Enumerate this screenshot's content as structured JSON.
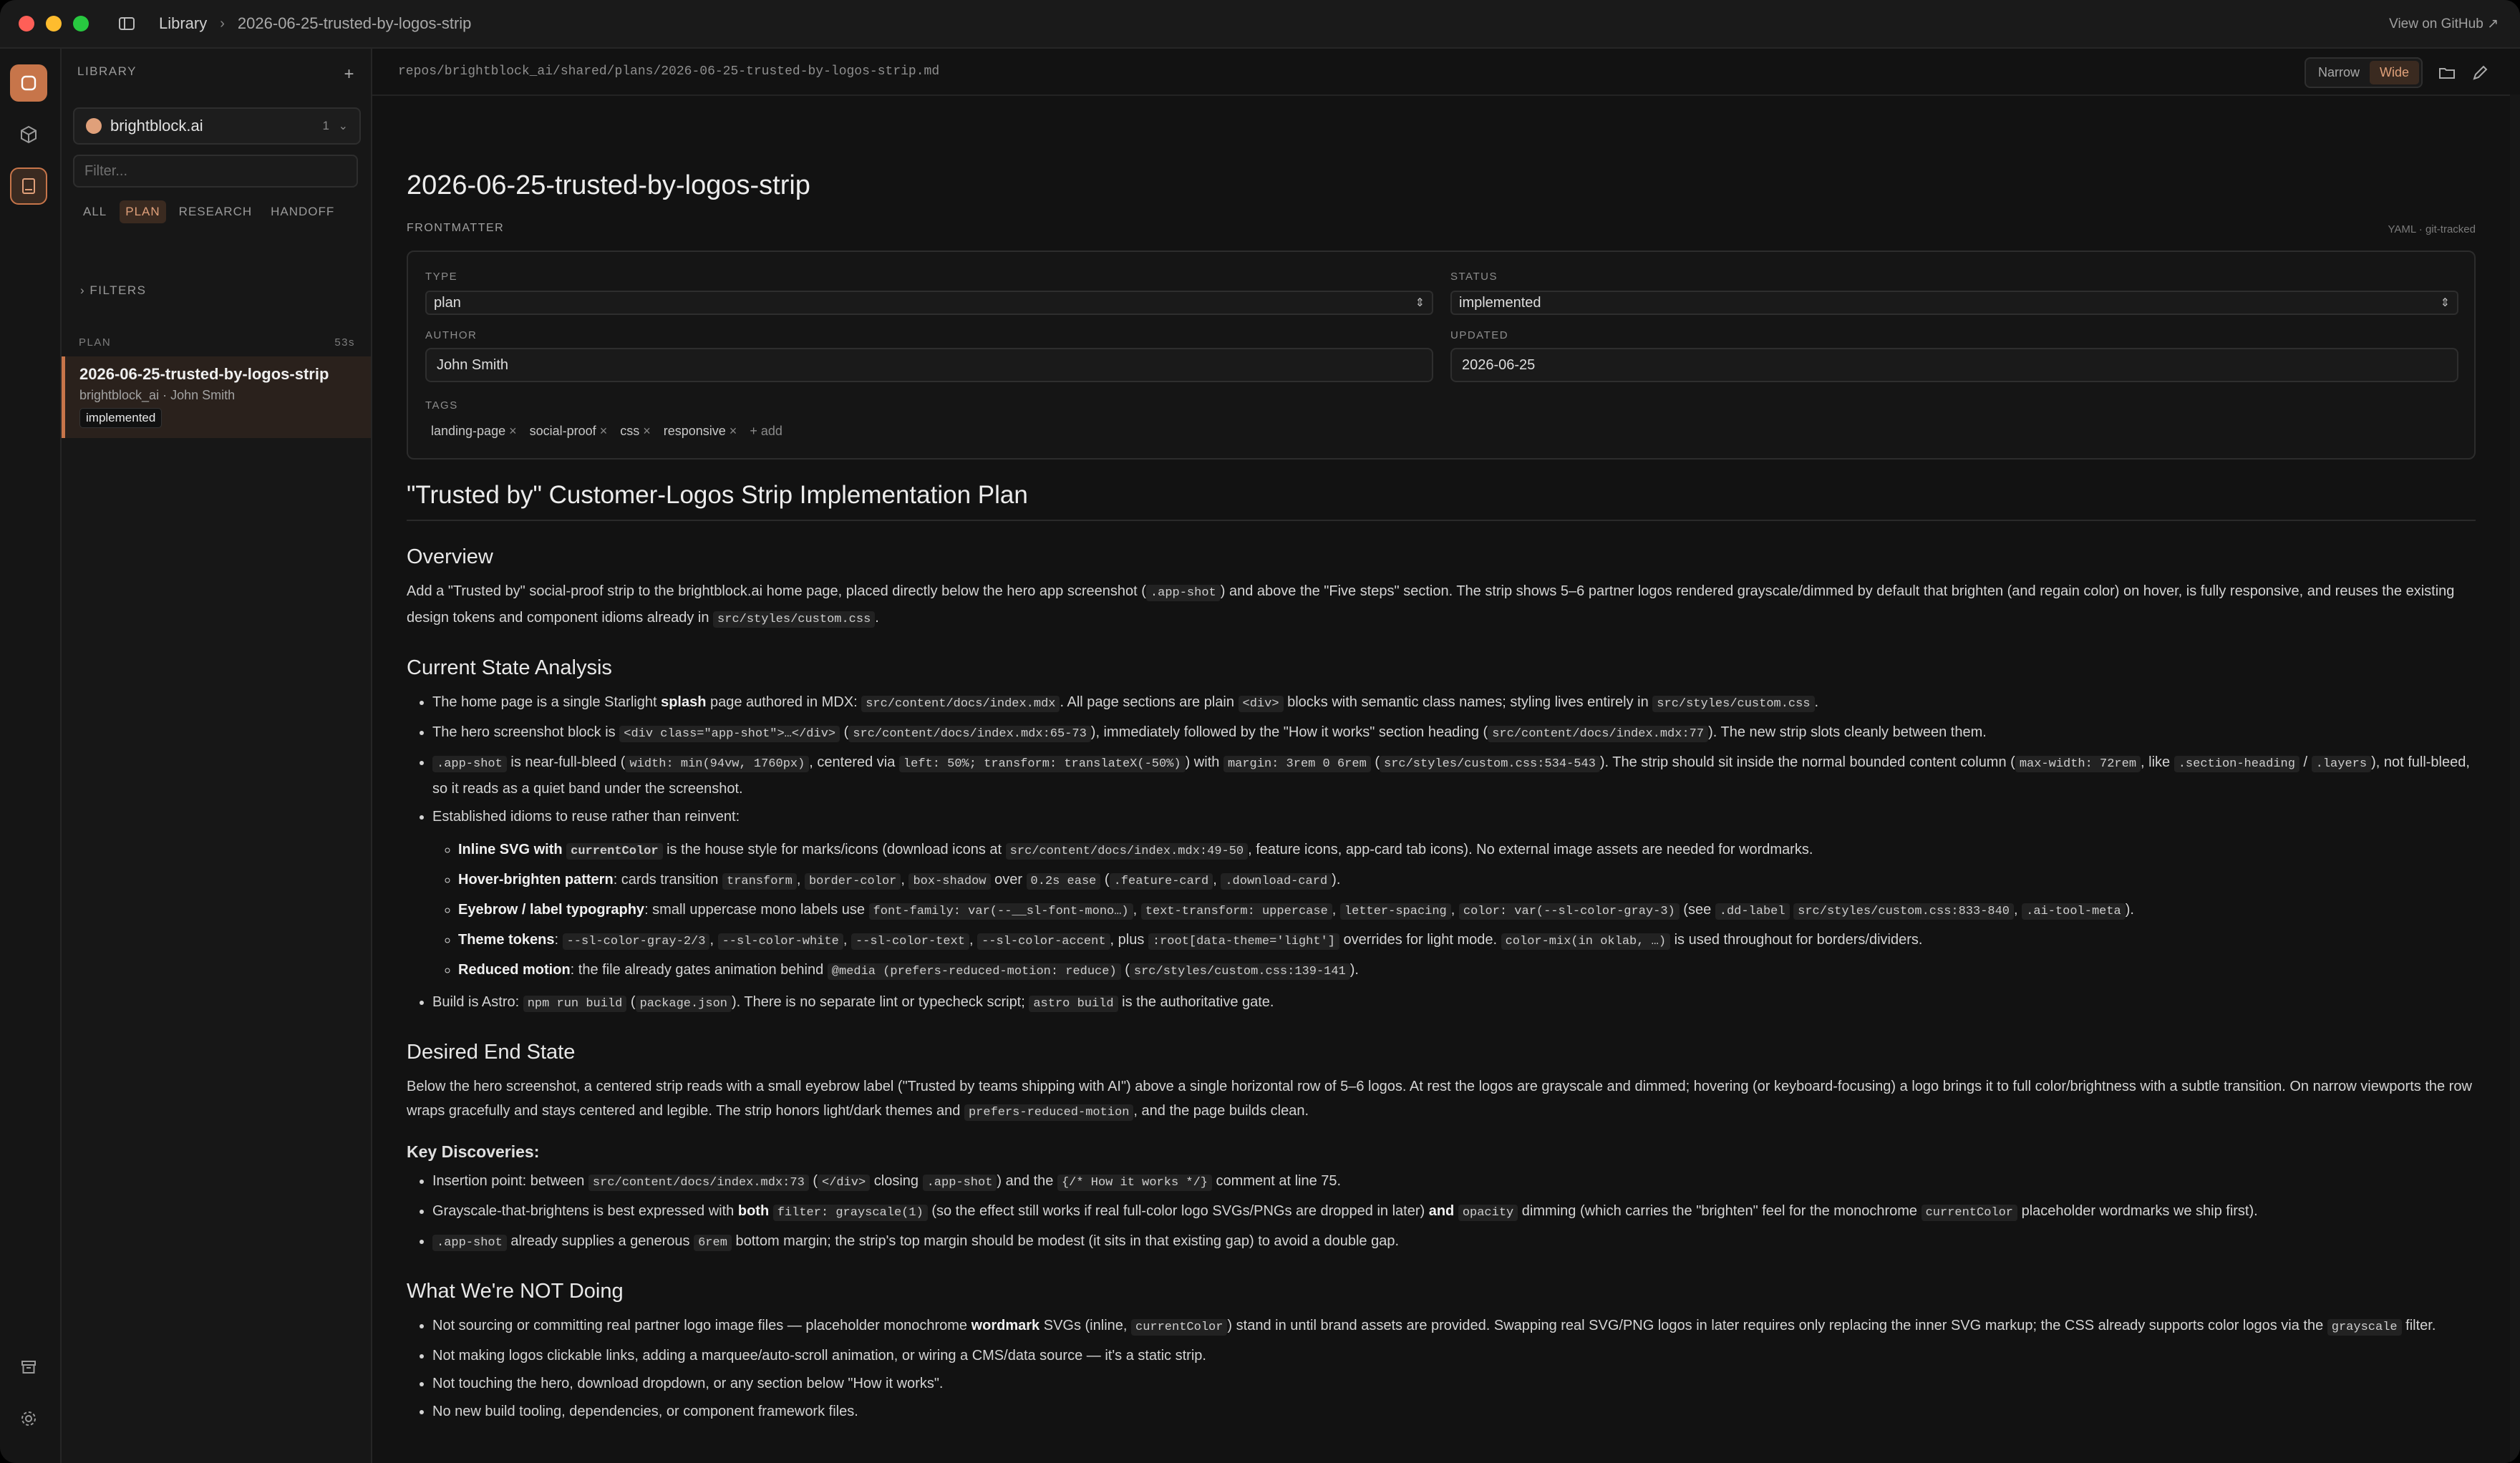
{
  "colors": {
    "accent": "#c7754a",
    "close": "#ff5f57",
    "minimize": "#febc2e",
    "zoom": "#28c840"
  },
  "titlebar": {
    "crumb_root": "Library",
    "crumb_current": "2026-06-25-trusted-by-logos-strip",
    "github_link": "View on GitHub ↗"
  },
  "rail": {
    "icons": [
      "home-icon",
      "cube-icon",
      "book-icon",
      "archive-icon",
      "gear-icon"
    ]
  },
  "sidebar": {
    "header": "LIBRARY",
    "add": "+",
    "workspace": {
      "name": "brightblock.ai",
      "count": "1"
    },
    "filter_placeholder": "Filter...",
    "chips": [
      "ALL",
      "PLAN",
      "RESEARCH",
      "HANDOFF"
    ],
    "active_chip": "PLAN",
    "filters_toggle": "› FILTERS",
    "section": {
      "label": "PLAN",
      "age": "53s"
    },
    "item": {
      "title": "2026-06-25-trusted-by-logos-strip",
      "meta": "brightblock_ai · John Smith",
      "badge": "implemented"
    }
  },
  "pathbar": {
    "path": "repos/brightblock_ai/shared/plans/2026-06-25-trusted-by-logos-strip.md",
    "narrow": "Narrow",
    "wide": "Wide",
    "active_width": "Wide"
  },
  "doc": {
    "title": "2026-06-25-trusted-by-logos-strip",
    "frontmatter_label": "FRONTMATTER",
    "frontmatter_meta": "YAML · git-tracked",
    "fields": {
      "type_label": "TYPE",
      "type_value": "plan",
      "status_label": "STATUS",
      "status_value": "implemented",
      "author_label": "AUTHOR",
      "author_value": "John Smith",
      "updated_label": "UPDATED",
      "updated_value": "2026-06-25",
      "tags_label": "TAGS"
    },
    "tags": [
      "landing-page",
      "social-proof",
      "css",
      "responsive"
    ],
    "add_tag": "+ add",
    "h1": "\"Trusted by\" Customer-Logos Strip Implementation Plan",
    "overview_h": "Overview",
    "current_h": "Current State Analysis",
    "desired_h": "Desired End State",
    "key_h": "Key Discoveries:",
    "not_h": "What We're NOT Doing"
  }
}
